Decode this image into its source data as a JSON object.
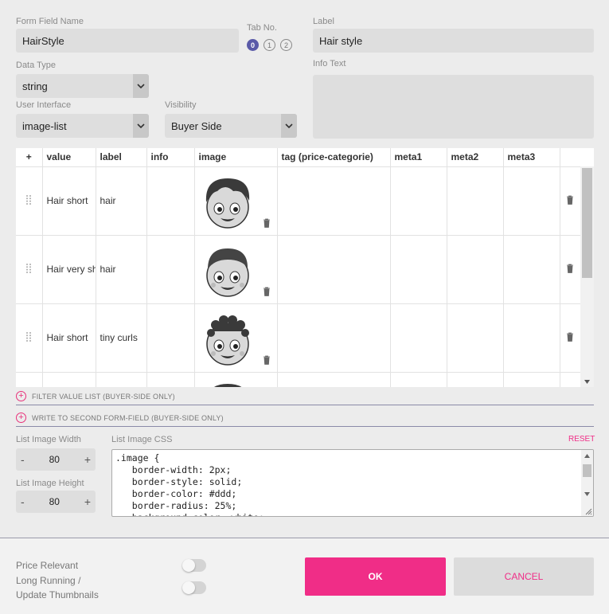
{
  "form": {
    "field_name_label": "Form Field Name",
    "field_name_value": "HairStyle",
    "tab_no_label": "Tab No.",
    "tabs": [
      "0",
      "1",
      "2"
    ],
    "label_label": "Label",
    "label_value": "Hair style",
    "data_type_label": "Data Type",
    "data_type_value": "string",
    "info_text_label": "Info Text",
    "ui_label": "User Interface",
    "ui_value": "image-list",
    "visibility_label": "Visibility",
    "visibility_value": "Buyer Side"
  },
  "table": {
    "add_symbol": "+",
    "headers": [
      "value",
      "label",
      "info",
      "image",
      "tag (price-categorie)",
      "meta1",
      "meta2",
      "meta3"
    ],
    "rows": [
      {
        "value": "Hair short",
        "label": "hair",
        "info": ""
      },
      {
        "value": "Hair very short",
        "label": "hair",
        "info": ""
      },
      {
        "value": "Hair short",
        "label": "tiny curls",
        "info": ""
      }
    ]
  },
  "sections": {
    "filter": "FILTER VALUE LIST (BUYER-SIDE ONLY)",
    "write": "WRITE TO SECOND FORM-FIELD (BUYER-SIDE ONLY)"
  },
  "image_settings": {
    "width_label": "List Image Width",
    "width_value": "80",
    "height_label": "List Image Height",
    "height_value": "80",
    "minus": "-",
    "plus": "+",
    "css_label": "List Image CSS",
    "reset_label": "RESET",
    "css_text": ".image {\n   border-width: 2px;\n   border-style: solid;\n   border-color: #ddd;\n   border-radius: 25%;\n   background-color: white;"
  },
  "footer": {
    "price_relevant": "Price Relevant",
    "long_running": "Long Running /",
    "update_thumbnails": "Update Thumbnails",
    "ok": "OK",
    "cancel": "CANCEL"
  },
  "colors": {
    "accent": "#f02d87",
    "tab_active": "#5a5aa8"
  }
}
